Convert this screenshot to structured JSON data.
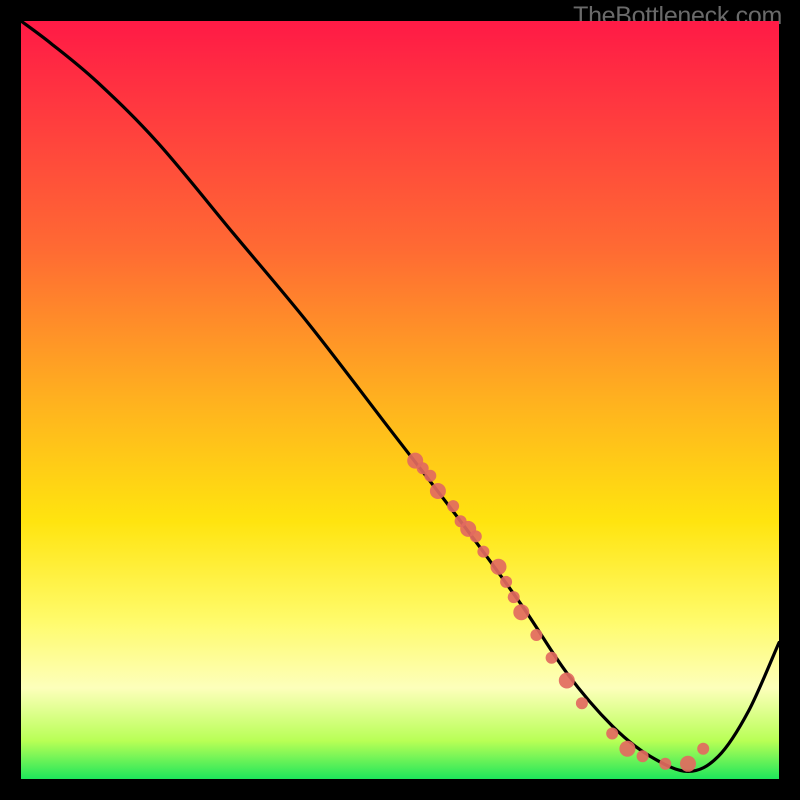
{
  "attribution": "TheBottleneck.com",
  "chart_data": {
    "type": "line",
    "title": "",
    "xlabel": "",
    "ylabel": "",
    "xlim": [
      0,
      100
    ],
    "ylim": [
      0,
      100
    ],
    "series": [
      {
        "name": "curve",
        "x": [
          0,
          4,
          10,
          18,
          28,
          38,
          48,
          58,
          66,
          72,
          78,
          83,
          88,
          92,
          96,
          100
        ],
        "y": [
          100,
          97,
          92,
          84,
          72,
          60,
          47,
          34,
          23,
          14,
          7,
          3,
          1,
          3,
          9,
          18
        ]
      }
    ],
    "points": {
      "name": "markers",
      "color": "#e26a60",
      "x": [
        52,
        53,
        54,
        55,
        57,
        58,
        59,
        60,
        61,
        63,
        64,
        65,
        66,
        68,
        70,
        72,
        74,
        78,
        80,
        82,
        85,
        88,
        90
      ],
      "y": [
        42,
        41,
        40,
        38,
        36,
        34,
        33,
        32,
        30,
        28,
        26,
        24,
        22,
        19,
        16,
        13,
        10,
        6,
        4,
        3,
        2,
        2,
        4
      ]
    }
  }
}
